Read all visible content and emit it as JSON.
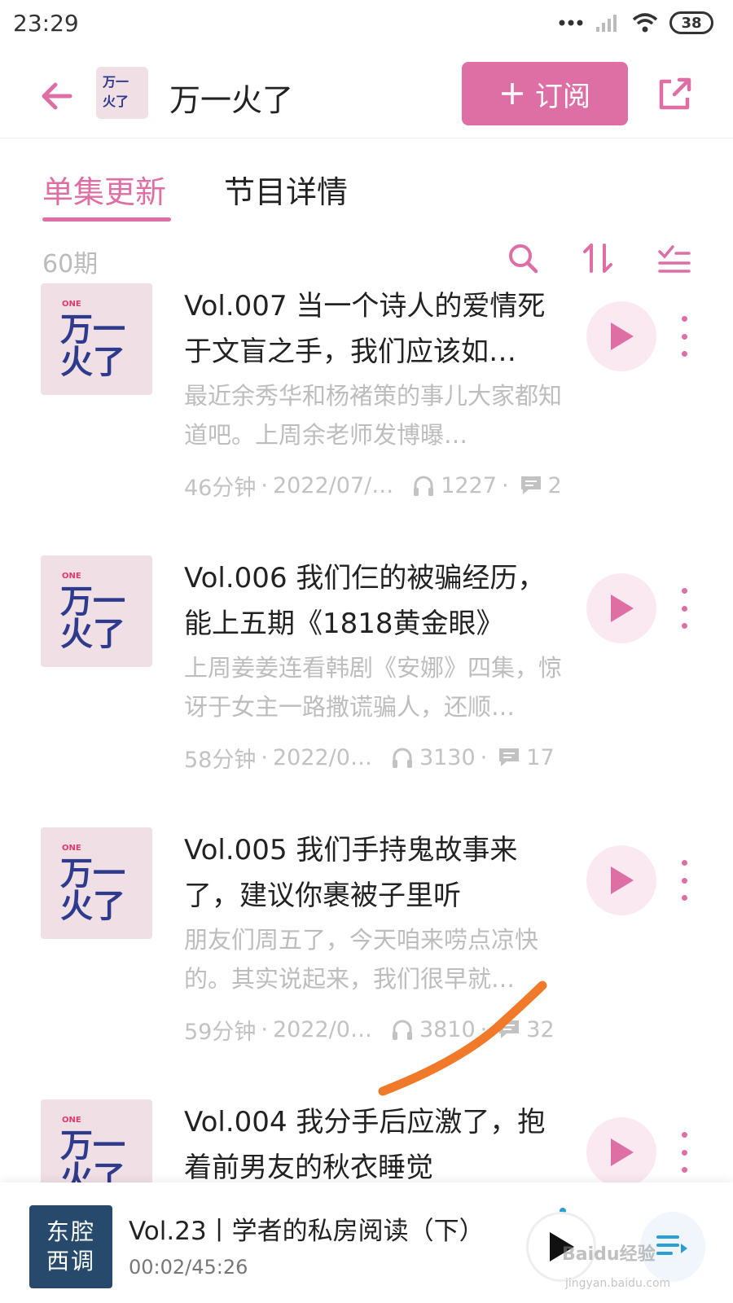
{
  "status_bar": {
    "time": "23:29",
    "battery": "38"
  },
  "header": {
    "title": "万一火了",
    "subscribe_label": "订阅",
    "thumb_label": "万一火了"
  },
  "tabs": [
    {
      "label": "单集更新",
      "active": true
    },
    {
      "label": "节目详情",
      "active": false
    }
  ],
  "list_toolbar": {
    "count": "60期"
  },
  "episodes": [
    {
      "title": "Vol.007 当一个诗人的爱情死于文盲之手，我们应该如…",
      "desc": "最近余秀华和杨褚策的事儿大家都知道吧。上周余老师发博曝…",
      "duration": "46分钟",
      "date": "2022/07/…",
      "plays": "1227",
      "comments": "2"
    },
    {
      "title": "Vol.006 我们仨的被骗经历，能上五期《1818黄金眼》",
      "desc": "上周姜姜连看韩剧《安娜》四集，惊讶于女主一路撒谎骗人，还顺…",
      "duration": "58分钟",
      "date": "2022/0…",
      "plays": "3130",
      "comments": "17"
    },
    {
      "title": "Vol.005 我们手持鬼故事来了，建议你裹被子里听",
      "desc": "朋友们周五了，今天咱来唠点凉快的。其实说起来，我们很早就…",
      "duration": "59分钟",
      "date": "2022/0…",
      "plays": "3810",
      "comments": "32"
    },
    {
      "title": "Vol.004 我分手后应激了，抱着前男友的秋衣睡觉",
      "desc": "",
      "duration": "",
      "date": "",
      "plays": "",
      "comments": ""
    }
  ],
  "player": {
    "cover_line1": "东腔",
    "cover_line2": "西调",
    "title": "Vol.23丨学者的私房阅读（下）",
    "time": "00:02/45:26"
  },
  "watermark": {
    "text": "Baidu经验",
    "sub": "jingyan.baidu.com"
  },
  "colors": {
    "accent": "#de6fa4",
    "thumb_bg": "#f1dfe6",
    "logo_blue": "#2e3a8c",
    "annotation": "#f07a2a",
    "player_cover": "#274a6c"
  }
}
